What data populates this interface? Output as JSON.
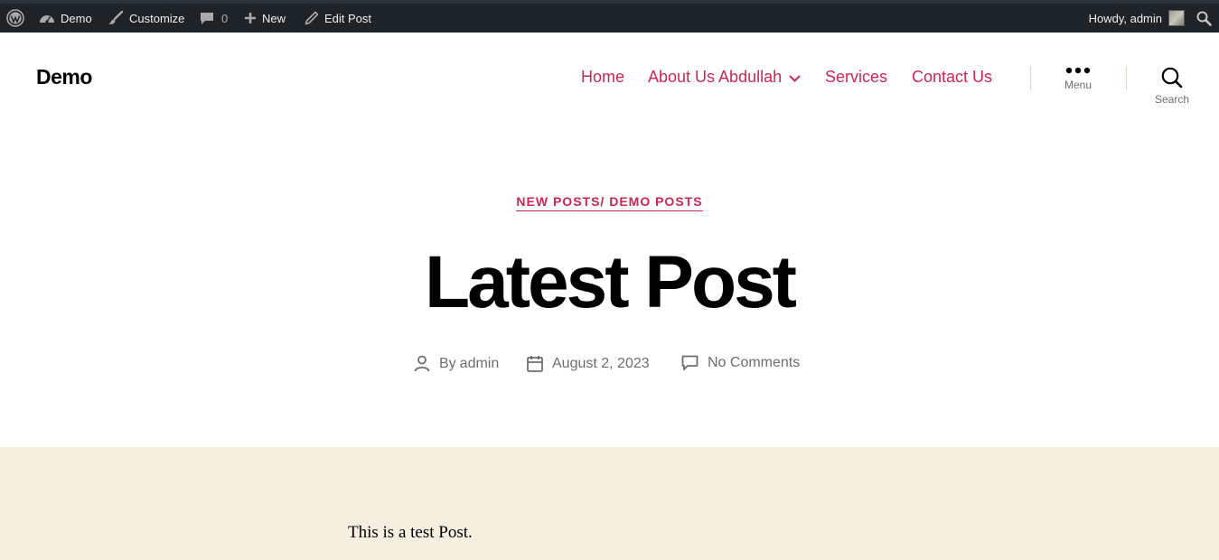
{
  "admin_bar": {
    "site_name": "Demo",
    "customize": "Customize",
    "comments_count": "0",
    "new": "New",
    "edit_post": "Edit Post",
    "howdy": "Howdy, admin"
  },
  "header": {
    "site_title": "Demo",
    "nav": {
      "home": "Home",
      "about": "About Us Abdullah",
      "services": "Services",
      "contact": "Contact Us"
    },
    "menu_label": "Menu",
    "search_label": "Search"
  },
  "post": {
    "categories": "NEW POSTS/ DEMO POSTS",
    "title": "Latest Post",
    "by_prefix": "By",
    "author": "admin",
    "date": "August 2, 2023",
    "comments": "No Comments",
    "body": "This is a test Post."
  },
  "colors": {
    "accent": "#cd2653",
    "admin_bar_bg": "#1d2327",
    "content_bg": "#f5efe0",
    "meta_text": "#6d6d6d"
  },
  "icons": [
    "wordpress-logo-icon",
    "dashboard-icon",
    "brush-icon",
    "comment-bubble-icon",
    "plus-icon",
    "pencil-icon",
    "search-icon",
    "chevron-down-icon",
    "ellipsis-icon",
    "person-icon",
    "calendar-icon",
    "comment-icon"
  ]
}
